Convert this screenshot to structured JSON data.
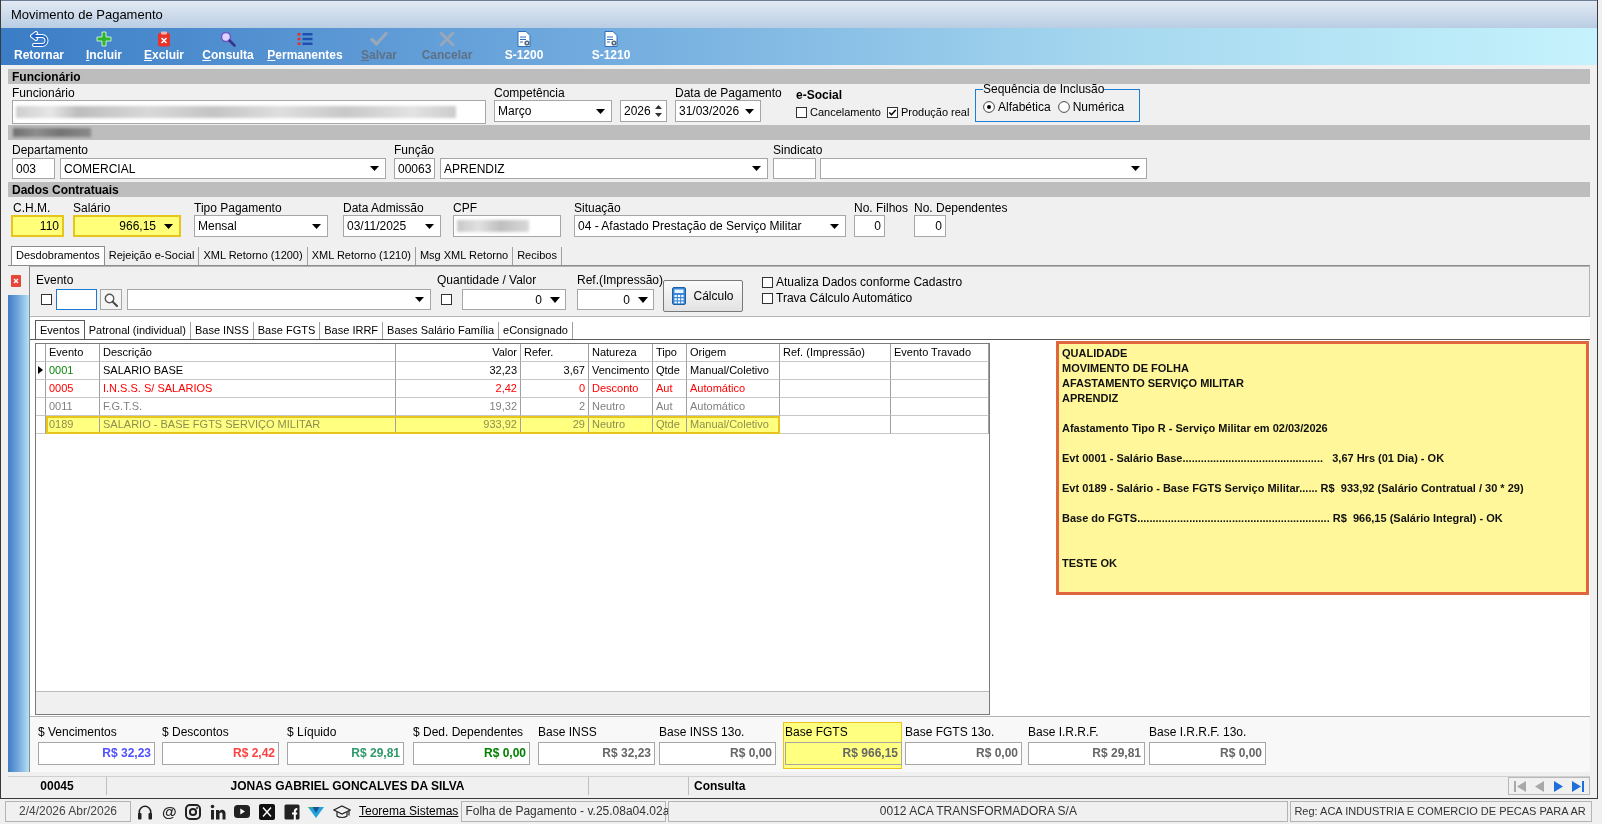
{
  "window": {
    "title": "Movimento de Pagamento"
  },
  "toolbar": [
    {
      "label": "Retornar",
      "underlined_initial": false,
      "disabled": false
    },
    {
      "label": "Incluir",
      "underlined_initial": true,
      "disabled": false
    },
    {
      "label": "Excluir",
      "underlined_initial": true,
      "disabled": false
    },
    {
      "label": "Consulta",
      "underlined_initial": true,
      "disabled": false
    },
    {
      "label": "Permanentes",
      "underlined_initial": true,
      "disabled": false
    },
    {
      "label": "Salvar",
      "underlined_initial": true,
      "disabled": true
    },
    {
      "label": "Cancelar",
      "underlined_initial": false,
      "disabled": true
    },
    {
      "label": "S-1200",
      "underlined_initial": false,
      "disabled": false
    },
    {
      "label": "S-1210",
      "underlined_initial": false,
      "disabled": false
    }
  ],
  "employee_section": {
    "title": "Funcionário",
    "employee_label": "Funcionário",
    "competencia": {
      "label": "Competência",
      "month": "Março",
      "year": "2026"
    },
    "data_pagamento": {
      "label": "Data de Pagamento",
      "value": "31/03/2026"
    },
    "esocial": {
      "title": "e-Social",
      "options": [
        {
          "label": "Cancelamento",
          "checked": false
        },
        {
          "label": "Produção real",
          "checked": true
        }
      ]
    },
    "sequencia": {
      "title": "Sequência de Inclusão",
      "options": [
        {
          "label": "Alfabética",
          "selected": true
        },
        {
          "label": "Numérica",
          "selected": false
        }
      ]
    },
    "departamento": {
      "label": "Departamento",
      "code": "003",
      "name": "COMERCIAL"
    },
    "funcao": {
      "label": "Função",
      "code": "00063",
      "name": "APRENDIZ"
    },
    "sindicato": {
      "label": "Sindicato"
    }
  },
  "contract_section": {
    "title": "Dados Contratuais",
    "fields": [
      {
        "label": "C.H.M.",
        "value": "110",
        "kind": "number",
        "highlighted": true
      },
      {
        "label": "Salário",
        "value": "966,15",
        "kind": "amount",
        "highlighted": true
      },
      {
        "label": "Tipo Pagamento",
        "value": "Mensal",
        "kind": "select",
        "highlighted": false
      },
      {
        "label": "Data Admissão",
        "value": "03/11/2025",
        "kind": "select",
        "highlighted": false
      },
      {
        "label": "CPF",
        "kind": "redacted",
        "highlighted": false
      },
      {
        "label": "Situação",
        "value": "04 - Afastado Prestação de Serviço Militar",
        "kind": "select",
        "highlighted": false
      },
      {
        "label": "No. Filhos",
        "value": "0",
        "kind": "number",
        "highlighted": false
      },
      {
        "label": "No. Dependentes",
        "value": "0",
        "kind": "number",
        "highlighted": false
      }
    ]
  },
  "tabs": [
    {
      "label": "Desdobramentos",
      "selected": true
    },
    {
      "label": "Rejeição e-Social",
      "selected": false
    },
    {
      "label": "XML Retorno (1200)",
      "selected": false
    },
    {
      "label": "XML Retorno (1210)",
      "selected": false
    },
    {
      "label": "Msg XML Retorno",
      "selected": false
    },
    {
      "label": "Recibos",
      "selected": false
    }
  ],
  "event_entry": {
    "evento_label": "Evento",
    "evento_checked": false,
    "quantity_label": "Quantidade / Valor",
    "quantity_checked": false,
    "quantity_value": "0",
    "ref_label": "Ref.(Impressão)",
    "ref_value": "0",
    "calc_button": "Cálculo",
    "options": [
      {
        "label": "Atualiza Dados conforme Cadastro",
        "checked": false
      },
      {
        "label": "Trava Cálculo Automático",
        "checked": false
      }
    ]
  },
  "subtabs": [
    {
      "label": "Eventos",
      "selected": true
    },
    {
      "label": "Patronal (individual)",
      "selected": false
    },
    {
      "label": "Base INSS",
      "selected": false
    },
    {
      "label": "Base FGTS",
      "selected": false
    },
    {
      "label": "Base IRRF",
      "selected": false
    },
    {
      "label": "Bases Salário Família",
      "selected": false
    },
    {
      "label": "eConsignado",
      "selected": false
    }
  ],
  "grid": {
    "columns": [
      "Evento",
      "Descrição",
      "Valor",
      "Refer.",
      "Natureza",
      "Tipo",
      "Origem",
      "Ref. (Impressão)",
      "Evento Travado"
    ],
    "rows": [
      {
        "kind": "earning",
        "selected": true,
        "highlighted": false,
        "cells": [
          "0001",
          "SALARIO BASE",
          "32,23",
          "3,67",
          "Vencimento",
          "Qtde",
          "Manual/Coletivo"
        ]
      },
      {
        "kind": "deduction",
        "selected": false,
        "highlighted": false,
        "cells": [
          "0005",
          "I.N.S.S. S/ SALARIOS",
          "2,42",
          "0",
          "Desconto",
          "Aut",
          "Automático"
        ]
      },
      {
        "kind": "neutral",
        "selected": false,
        "highlighted": false,
        "cells": [
          "0011",
          "F.G.T.S.",
          "19,32",
          "2",
          "Neutro",
          "Aut",
          "Automático"
        ]
      },
      {
        "kind": "neutral",
        "selected": false,
        "highlighted": true,
        "cells": [
          "0189",
          "SALARIO - BASE FGTS SERVIÇO MILITAR",
          "933,92",
          "29",
          "Neutro",
          "Qtde",
          "Manual/Coletivo"
        ]
      }
    ]
  },
  "note": {
    "text": "QUALIDADE\nMOVIMENTO DE FOLHA\nAFASTAMENTO SERVIÇO MILITAR\nAPRENDIZ\n\nAfastamento Tipo R - Serviço Militar em 02/03/2026\n\nEvt 0001 - Salário Base..............................................   3,67 Hrs (01 Dia) - OK\n\nEvt 0189 - Salário - Base FGTS Serviço Militar...... R$  933,92 (Salário Contratual / 30 * 29)\n\nBase do FGTS............................................................... R$  966,15 (Salário Integral) - OK\n\n\nTESTE OK"
  },
  "totals": [
    {
      "label": "$ Vencimentos",
      "value": "R$ 32,23",
      "color": "#5050ff",
      "highlighted": false
    },
    {
      "label": "$ Descontos",
      "value": "R$ 2,42",
      "color": "#ff4040",
      "highlighted": false
    },
    {
      "label": "$ Líquido",
      "value": "R$ 29,81",
      "color": "#2e9a6a",
      "highlighted": false
    },
    {
      "label": "$ Ded. Dependentes",
      "value": "R$ 0,00",
      "color": "#008000",
      "highlighted": false
    },
    {
      "label": "Base INSS",
      "value": "R$ 32,23",
      "color": "#666666",
      "highlighted": false
    },
    {
      "label": "Base INSS 13o.",
      "value": "R$ 0,00",
      "color": "#666666",
      "highlighted": false
    },
    {
      "label": "Base FGTS",
      "value": "R$ 966,15",
      "color": "#666666",
      "highlighted": true
    },
    {
      "label": "Base FGTS 13o.",
      "value": "R$ 0,00",
      "color": "#666666",
      "highlighted": false
    },
    {
      "label": "Base I.R.R.F.",
      "value": "R$ 29,81",
      "color": "#666666",
      "highlighted": false
    },
    {
      "label": "Base I.R.R.F. 13o.",
      "value": "R$ 0,00",
      "color": "#666666",
      "highlighted": false
    }
  ],
  "status_bar": {
    "code": "00045",
    "name": "JONAS GABRIEL GONCALVES DA SILVA",
    "mode": "Consulta",
    "nav": [
      {
        "disabled": true
      },
      {
        "disabled": true
      },
      {
        "disabled": false
      },
      {
        "disabled": false
      }
    ]
  },
  "footer": {
    "date": "2/4/2026 Abr/2026",
    "email_glyph": "@",
    "link": "Teorema Sistemas",
    "version": "Folha de Pagamento - v.25.08a04.02a",
    "company": "0012 ACA TRANSFORMADORA S/A",
    "registry": "Reg: ACA INDUSTRIA E COMERCIO DE PECAS PARA AR"
  }
}
